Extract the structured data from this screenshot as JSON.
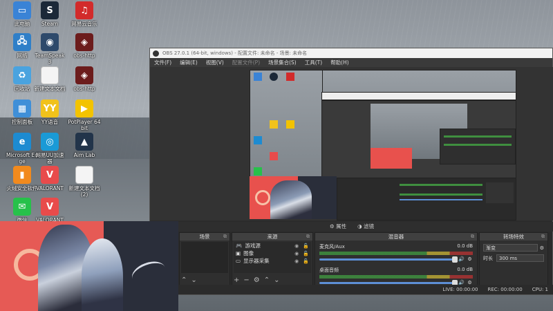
{
  "desktop": {
    "icons": [
      {
        "name": "this-pc",
        "label": "此电脑",
        "color": "#3a83d6",
        "glyph": "▭"
      },
      {
        "name": "steam",
        "label": "Steam",
        "color": "#1b2838",
        "glyph": "S"
      },
      {
        "name": "netease-music",
        "label": "网易云音乐",
        "color": "#d22b2b",
        "glyph": "♫"
      },
      {
        "name": "network",
        "label": "网络",
        "color": "#2f7fc8",
        "glyph": "🖧"
      },
      {
        "name": "teamspeak",
        "label": "TeamSpeak 3",
        "color": "#2e4a6b",
        "glyph": "◉"
      },
      {
        "name": "obs",
        "label": "obs-http",
        "color": "#6c1c1c",
        "glyph": "◈"
      },
      {
        "name": "recycle-bin",
        "label": "回收站",
        "color": "#4aa3df",
        "glyph": "♻"
      },
      {
        "name": "new-text-doc",
        "label": "新建文本文档",
        "color": "#f4f4f4",
        "glyph": ""
      },
      {
        "name": "obs2",
        "label": "obs-http",
        "color": "#6c1c1c",
        "glyph": "◈"
      },
      {
        "name": "control-panel",
        "label": "控制面板",
        "color": "#3f8fd8",
        "glyph": "▦"
      },
      {
        "name": "yy",
        "label": "YY语音",
        "color": "#f1c21b",
        "glyph": "YY"
      },
      {
        "name": "potplayer",
        "label": "PotPlayer 64 bit",
        "color": "#f3c300",
        "glyph": "▶"
      },
      {
        "name": "edge",
        "label": "Microsoft Edge",
        "color": "#1d8bd1",
        "glyph": "e"
      },
      {
        "name": "uu",
        "label": "网易UU加速器",
        "color": "#1a9ad6",
        "glyph": "◎"
      },
      {
        "name": "aimlab",
        "label": "Aim Lab",
        "color": "#22344a",
        "glyph": "▲"
      },
      {
        "name": "huorong",
        "label": "火绒安全软件",
        "color": "#f28a1d",
        "glyph": "▮"
      },
      {
        "name": "valorant",
        "label": "VALORANT",
        "color": "#e84b4b",
        "glyph": "V"
      },
      {
        "name": "new-text-doc2",
        "label": "新建文本文档 (2)",
        "color": "#f4f4f4",
        "glyph": ""
      },
      {
        "name": "wechat",
        "label": "微信",
        "color": "#27c14a",
        "glyph": "✉"
      },
      {
        "name": "valorant2",
        "label": "VALORANT",
        "color": "#e84b4b",
        "glyph": "V"
      }
    ]
  },
  "obs": {
    "title": "OBS 27.0.1 (64-bit, windows) - 配置文件: 未命名 - 场景: 未命名",
    "menu": [
      "文件(F)",
      "编辑(E)",
      "视图(V)",
      "配置文件(P)",
      "场景集合(S)",
      "工具(T)",
      "帮助(H)"
    ],
    "props_label": "属性",
    "filters_label": "滤镜",
    "scenes_header": "场景",
    "sources_header": "来源",
    "mixer_header": "混音器",
    "transition_header": "转场特效",
    "sources": [
      {
        "label": "游戏源",
        "icon": "gamepad"
      },
      {
        "label": "图像",
        "icon": "image"
      },
      {
        "label": "显示器采集",
        "icon": "monitor"
      }
    ],
    "mixer": [
      {
        "label": "麦克风/Aux",
        "db": "0.0 dB"
      },
      {
        "label": "桌面音频",
        "db": "0.0 dB"
      }
    ],
    "transition": {
      "type": "渐变",
      "duration_label": "时长",
      "duration": "300 ms"
    },
    "status": {
      "live": "LIVE: 00:00:00",
      "rec": "REC: 00:00:00",
      "cpu": "CPU: 1"
    }
  }
}
